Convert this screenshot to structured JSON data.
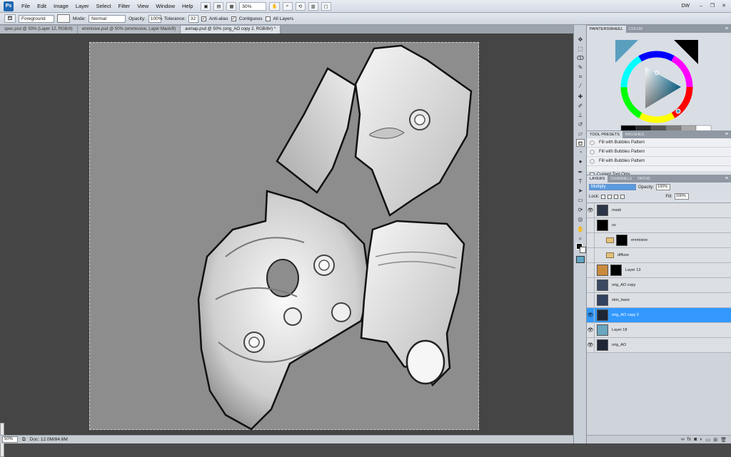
{
  "menubar": {
    "logo": "Ps",
    "items": [
      "File",
      "Edit",
      "Image",
      "Layer",
      "Select",
      "Filter",
      "View",
      "Window",
      "Help"
    ],
    "zoom": "50%",
    "workspace": "DW"
  },
  "options": {
    "fill_source": "Foreground",
    "mode_label": "Mode:",
    "mode_value": "Normal",
    "opacity_label": "Opacity:",
    "opacity_value": "100%",
    "tolerance_label": "Tolerance:",
    "tolerance_value": "32",
    "antialias_label": "Anti-alias",
    "contiguous_label": "Contiguous",
    "alllayers_label": "All Layers"
  },
  "tabs": [
    {
      "label": "spec.psd @ 50% (Layer 12, RGB/8)",
      "active": false
    },
    {
      "label": "emmisive.psd @ 50% (emmissive, Layer Mask/8)",
      "active": false
    },
    {
      "label": "aomap.psd @ 50% (orig_AO copy 2, RGB/8#) *",
      "active": true
    }
  ],
  "status": {
    "zoom": "50%",
    "doc": "Doc: 12.0M/84.6M"
  },
  "color_panel": {
    "tabs": [
      "PAINTERSWHEEL",
      "COLOR"
    ],
    "swatches": [
      "#000000",
      "#2a2a2a",
      "#555555",
      "#808080",
      "#aaaaaa",
      "#ffffff"
    ]
  },
  "tool_presets": {
    "tabs": [
      "TOOL PRESETS",
      "BRUSHES"
    ],
    "items": [
      "Fill with Bubbles Pattern",
      "Fill with Bubbles Pattern",
      "Fill with Bubbles Pattern"
    ],
    "current_only": "Current Tool Only"
  },
  "layers_panel": {
    "tabs": [
      "LAYERS",
      "CHANNELS",
      "PATHS"
    ],
    "blend_mode": "Multiply",
    "opacity_label": "Opacity:",
    "opacity_value": "100%",
    "lock_label": "Lock:",
    "fill_label": "Fill:",
    "fill_value": "100%",
    "layers": [
      {
        "name": "mask",
        "visible": true,
        "thumb": "#2b3548",
        "mask": false,
        "folder": false,
        "selected": false
      },
      {
        "name": "uv",
        "visible": false,
        "thumb": "#000000",
        "mask": false,
        "folder": false,
        "selected": false
      },
      {
        "name": "emmisive",
        "visible": false,
        "thumb": "",
        "mask": true,
        "folder": true,
        "selected": false
      },
      {
        "name": "diffuse",
        "visible": false,
        "thumb": "",
        "mask": false,
        "folder": true,
        "selected": false
      },
      {
        "name": "Layer 13",
        "visible": false,
        "thumb": "#c98a3e",
        "mask": true,
        "folder": false,
        "selected": false
      },
      {
        "name": "orig_AO copy",
        "visible": false,
        "thumb": "#3a4a63",
        "mask": false,
        "folder": false,
        "selected": false
      },
      {
        "name": "skin_base",
        "visible": false,
        "thumb": "#314160",
        "mask": false,
        "folder": false,
        "selected": false
      },
      {
        "name": "orig_AO copy 2",
        "visible": true,
        "thumb": "#1e2636",
        "mask": false,
        "folder": false,
        "selected": true
      },
      {
        "name": "Layer 18",
        "visible": true,
        "thumb": "#6aa6bf",
        "mask": false,
        "folder": false,
        "selected": false
      },
      {
        "name": "orig_AO",
        "visible": true,
        "thumb": "#1e2636",
        "mask": false,
        "folder": false,
        "selected": false
      }
    ]
  },
  "colors": {
    "selection": "#3399ff",
    "quickmask": "#5fa6c4"
  }
}
